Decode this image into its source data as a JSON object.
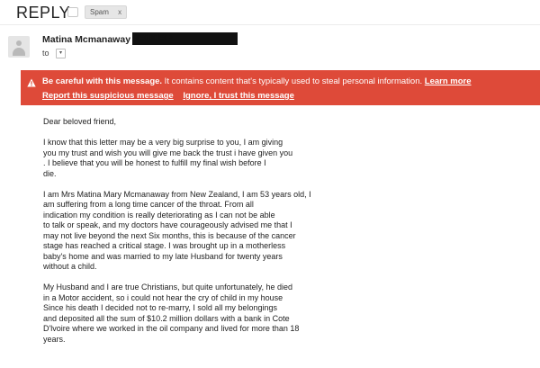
{
  "subject": "REPLY",
  "label": {
    "name": "Spam",
    "remove": "x"
  },
  "sender": {
    "name": "Matina Mcmanaway",
    "email_redacted": "<redacted>"
  },
  "to": {
    "label": "to",
    "dropdown": "▾"
  },
  "warning": {
    "title": "Be careful with this message.",
    "text": " It contains content that's typically used to steal personal information. ",
    "learn_more": "Learn more",
    "report": "Report this suspicious message",
    "ignore": "Ignore, I trust this message"
  },
  "body": {
    "greeting": "Dear beloved friend,",
    "paragraphs": [
      [
        "I know that this letter may be a very big surprise to you, I am giving",
        "you my trust and wish you will give me back the trust i have given you",
        ". I believe that you will be honest to fulfill my final wish before I",
        "die."
      ],
      [
        "I am Mrs Matina Mary Mcmanaway from New Zealand, I am 53 years old, I",
        "am suffering from a long time cancer of the throat. From all",
        "indication my condition is really deteriorating as I can not be able",
        "to talk or speak, and my doctors have courageously advised me that I",
        "may not live beyond the next Six months, this is because of the cancer",
        "stage has reached a critical stage. I was brought up in a motherless",
        "baby's home and was married to my late Husband for twenty years",
        "without a child."
      ],
      [
        "My Husband and I are true Christians, but quite unfortunately, he died",
        "in a Motor accident, so i could not hear the cry of child in my house",
        "Since his death I decided not to re-marry, I sold all my belongings",
        "and deposited all the sum of $10.2 million dollars with a bank in Cote",
        "D'lvoire where we worked in the oil company and lived for more than 18",
        "years."
      ]
    ]
  },
  "colors": {
    "warning_bg": "#de4a39",
    "warning_text": "#ffffff"
  }
}
